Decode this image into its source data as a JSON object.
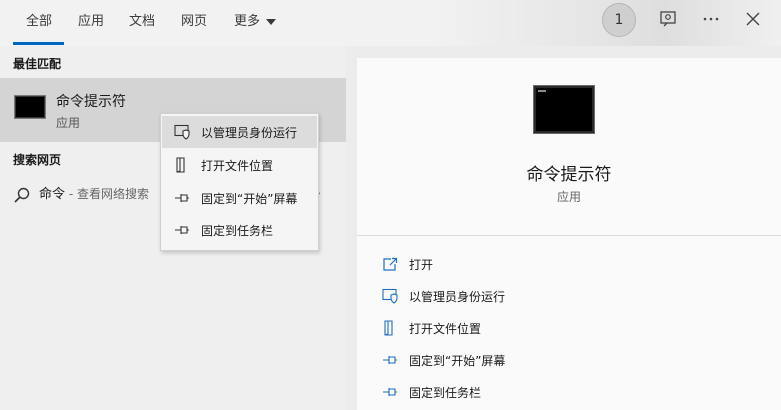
{
  "tabs": [
    {
      "label": "全部"
    },
    {
      "label": "应用"
    },
    {
      "label": "文档"
    },
    {
      "label": "网页"
    },
    {
      "label": "更多"
    }
  ],
  "header": {
    "badge_count": "1"
  },
  "left": {
    "best_match_heading": "最佳匹配",
    "best_match": {
      "title": "命令提示符",
      "subtitle": "应用"
    },
    "web_heading": "搜索网页",
    "web_result": {
      "query": "命令",
      "suffix": " - 查看网络搜索"
    }
  },
  "context_menu": {
    "items": [
      {
        "label": "以管理员身份运行",
        "icon": "shield-window-icon"
      },
      {
        "label": "打开文件位置",
        "icon": "file-location-icon"
      },
      {
        "label": "固定到“开始”屏幕",
        "icon": "pin-icon"
      },
      {
        "label": "固定到任务栏",
        "icon": "pin-icon"
      }
    ]
  },
  "detail": {
    "title": "命令提示符",
    "subtitle": "应用",
    "actions": [
      {
        "label": "打开",
        "icon": "open-icon"
      },
      {
        "label": "以管理员身份运行",
        "icon": "shield-window-icon"
      },
      {
        "label": "打开文件位置",
        "icon": "file-location-icon"
      },
      {
        "label": "固定到“开始”屏幕",
        "icon": "pin-icon"
      },
      {
        "label": "固定到任务栏",
        "icon": "pin-icon"
      }
    ]
  },
  "colors": {
    "accent": "#0067c0",
    "icon_blue": "#1e6fc0"
  }
}
